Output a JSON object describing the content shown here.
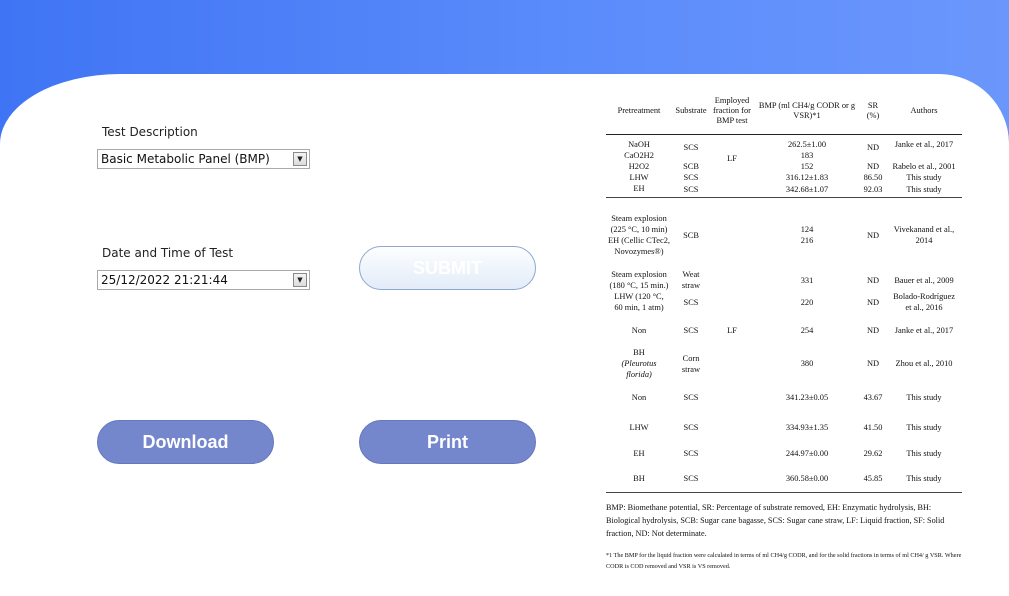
{
  "form": {
    "test_description_label": "Test Description",
    "test_description_value": "Basic Metabolic Panel (BMP)",
    "date_label": "Date and Time of Test",
    "date_value": "25/12/2022 21:21:44",
    "submit_label": "SUBMIT",
    "download_label": "Download",
    "print_label": "Print"
  },
  "table": {
    "headers": {
      "pretreatment": "Pretreatment",
      "substrate": "Substrate",
      "fraction": "Employed fraction for BMP test",
      "bmp": "BMP (ml CH4/g CODR or g VSR)*1",
      "sr": "SR (%)",
      "authors": "Authors"
    },
    "g1": {
      "pre": [
        "NaOH",
        "CaO2H2",
        "H2O2",
        "LHW",
        "EH"
      ],
      "sub": [
        "SCS",
        "SCB",
        "SCS",
        "SCS"
      ],
      "frac": "LF",
      "bmp": [
        "262.5±1.00",
        "183",
        "152",
        "316.12±1.83",
        "342.68±1.07"
      ],
      "sr": [
        "ND",
        "ND",
        "86.50",
        "92.03"
      ],
      "auth": [
        "Janke et al., 2017",
        "Rabelo et al., 2001",
        "This study",
        "This study"
      ]
    },
    "g2": {
      "r1_pre": [
        "Steam explosion",
        "(225 °C, 10 min)",
        "EH (Cellic CTec2,",
        "Novozymes®)"
      ],
      "r1_sub": "SCB",
      "r1_bmp": [
        "124",
        "216"
      ],
      "r1_sr": "ND",
      "r1_auth": [
        "Vivekanand et al.,",
        "2014"
      ],
      "r2_pre": [
        "Steam explosion",
        "(180 °C, 15 min.)"
      ],
      "r2_sub": [
        "Weat",
        "straw"
      ],
      "r2_bmp": "331",
      "r2_sr": "ND",
      "r2_auth": "Bauer et al., 2009",
      "r3_pre": [
        "LHW (120 °C,",
        "60 min, 1 atm)"
      ],
      "r3_sub": "SCS",
      "r3_bmp": "220",
      "r3_sr": "ND",
      "r3_auth": [
        "Bolado-Rodríguez",
        "et al., 2016"
      ],
      "r4_pre": "Non",
      "r4_sub": "SCS",
      "r4_frac": "LF",
      "r4_bmp": "254",
      "r4_sr": "ND",
      "r4_auth": "Janke et al., 2017",
      "r5_pre": [
        "BH",
        "(Pleurotus florida)"
      ],
      "r5_sub": [
        "Corn",
        "straw"
      ],
      "r5_bmp": "380",
      "r5_sr": "ND",
      "r5_auth": "Zhou et al., 2010",
      "r6": [
        "Non",
        "SCS",
        "341.23±0.05",
        "43.67",
        "This study"
      ],
      "r7": [
        "LHW",
        "SCS",
        "334.93±1.35",
        "41.50",
        "This study"
      ],
      "r8": [
        "EH",
        "SCS",
        "244.97±0.00",
        "29.62",
        "This study"
      ],
      "r9": [
        "BH",
        "SCS",
        "360.58±0.00",
        "45.85",
        "This study"
      ]
    },
    "notes": "BMP: Biomethane potential, SR: Percentage of substrate removed, EH: Enzymatic hydrolysis, BH: Biological hydrolysis, SCB: Sugar cane bagasse, SCS: Sugar cane straw, LF: Liquid fraction, SF: Solid fraction, ND: Not determinate.",
    "footnote": "*1 The BMP for the liquid fraction were calculated in terms of ml CH4/g CODR, and for the solid fractions in terms of ml CH4/ g VSR. Where CODR is COD removed and VSR is VS removed."
  }
}
